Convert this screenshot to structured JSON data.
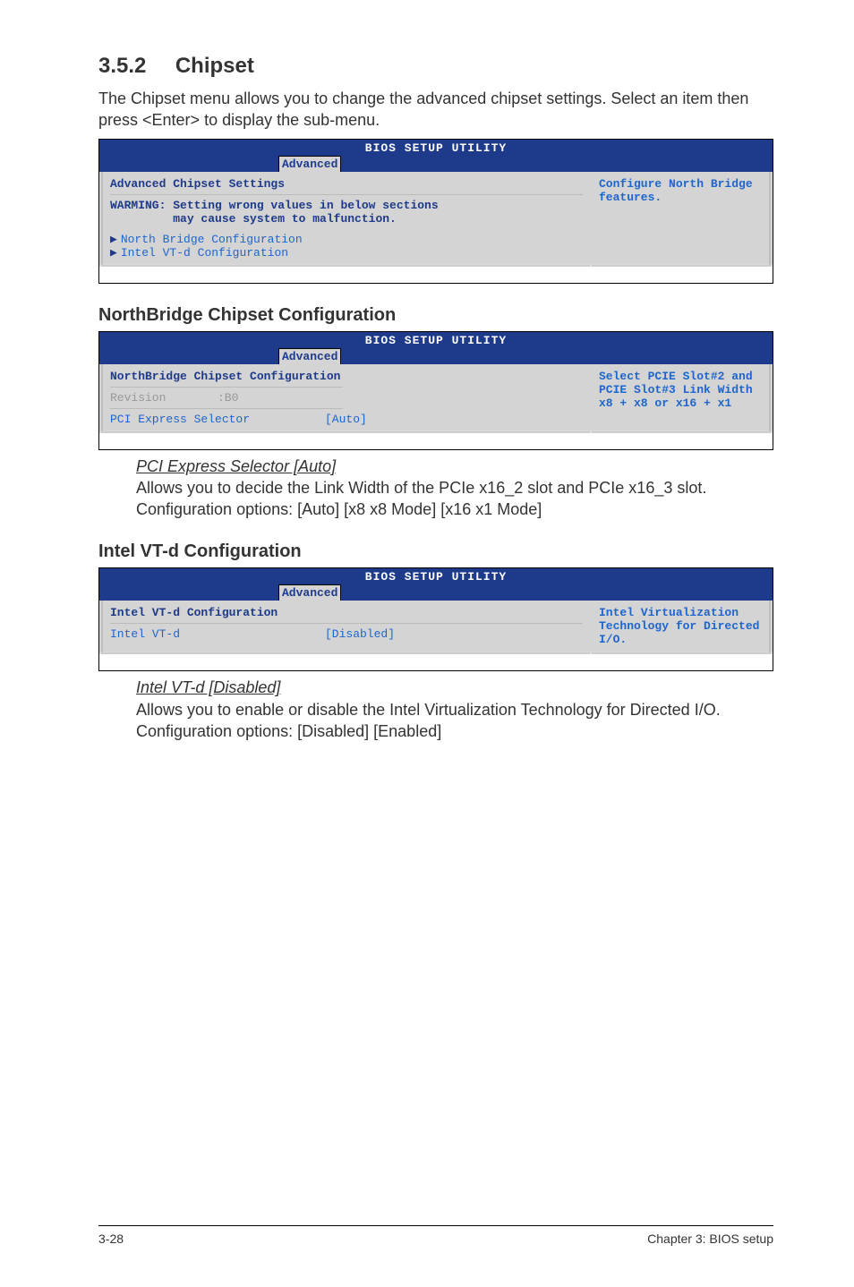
{
  "section": {
    "num": "3.5.2",
    "title": "Chipset"
  },
  "intro": "The Chipset menu allows you to change the advanced chipset settings. Select an item then press <Enter> to display the sub-menu.",
  "bios1": {
    "header": "BIOS SETUP UTILITY",
    "tab": "Advanced",
    "l1": "Advanced Chipset Settings",
    "l2a": "WARMING: Setting wrong values in below sections",
    "l2b": "         may cause system to malfunction.",
    "l3": "North Bridge Configuration",
    "l4": "Intel VT-d Configuration",
    "help": "Configure North Bridge features."
  },
  "sub1": {
    "title": "NorthBridge Chipset Configuration"
  },
  "bios2": {
    "header": "BIOS SETUP UTILITY",
    "tab": "Advanced",
    "l1": "NorthBridge Chipset Configuration",
    "rev_lbl": "Revision",
    "rev_val": ":B0",
    "pci_lbl": "PCI Express Selector",
    "pci_val": "[Auto]",
    "help": "Select PCIE Slot#2 and PCIE Slot#3 Link Width x8 + x8 or x16 + x1"
  },
  "item1": {
    "title": "PCI Express Selector [Auto]",
    "p1": "Allows you to decide the Link Width of the PCIe x16_2 slot and PCIe x16_3 slot.",
    "p2": "Configuration options: [Auto] [x8 x8 Mode] [x16 x1 Mode]"
  },
  "sub2": {
    "title": "Intel VT-d Configuration"
  },
  "bios3": {
    "header": "BIOS SETUP UTILITY",
    "tab": "Advanced",
    "l1": "Intel VT-d Configuration",
    "vt_lbl": "Intel VT-d",
    "vt_val": "[Disabled]",
    "help": "Intel Virtualization Technology for Directed I/O."
  },
  "item2": {
    "title": "Intel VT-d [Disabled]",
    "p1": "Allows you to enable or disable the Intel Virtualization Technology for Directed I/O.",
    "p2": "Configuration options: [Disabled] [Enabled]"
  },
  "footer": {
    "left": "3-28",
    "right": "Chapter 3: BIOS setup"
  }
}
